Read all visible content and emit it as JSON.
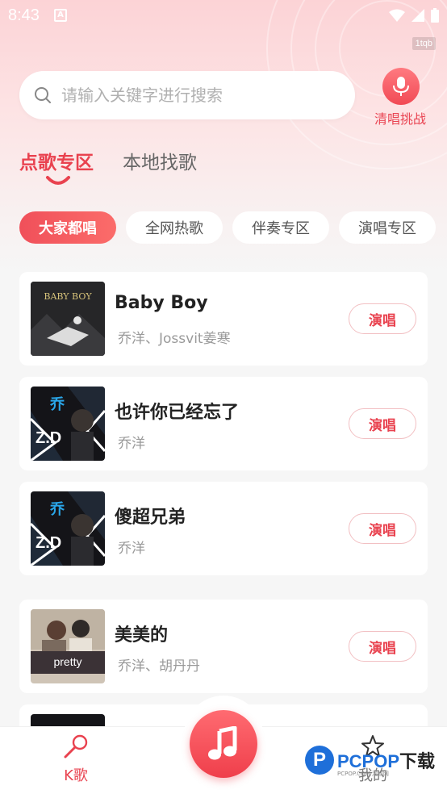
{
  "status_bar": {
    "time": "8:43",
    "badge": "1tqb"
  },
  "search": {
    "placeholder": "请输入关键字进行搜索"
  },
  "mic": {
    "label": "清唱挑战"
  },
  "tabs": [
    {
      "label": "点歌专区",
      "active": true
    },
    {
      "label": "本地找歌",
      "active": false
    }
  ],
  "chips": [
    {
      "label": "大家都唱",
      "active": true
    },
    {
      "label": "全网热歌",
      "active": false
    },
    {
      "label": "伴奏专区",
      "active": false
    },
    {
      "label": "演唱专区",
      "active": false
    }
  ],
  "songs": [
    {
      "title": "Baby Boy",
      "artist": "乔洋、Jossvit姜寒",
      "button": "演唱",
      "cover_text": "BABY BOY"
    },
    {
      "title": "也许你已经忘了",
      "artist": "乔洋",
      "button": "演唱",
      "cover_text": "Z.D"
    },
    {
      "title": "傻超兄弟",
      "artist": "乔洋",
      "button": "演唱",
      "cover_text": "Z.D"
    },
    {
      "title": "美美的",
      "artist": "乔洋、胡丹丹",
      "button": "演唱",
      "cover_text": "pretty"
    }
  ],
  "bottom_nav": {
    "k_label": "K歌",
    "mine_label": "我的"
  },
  "watermark": {
    "brand_a": "PCPOP",
    "brand_b": "下载",
    "sub": "PCPOP.COM·泡泡网"
  },
  "colors": {
    "accent": "#e9424f",
    "accent_gradient_end": "#fb6c6a"
  }
}
